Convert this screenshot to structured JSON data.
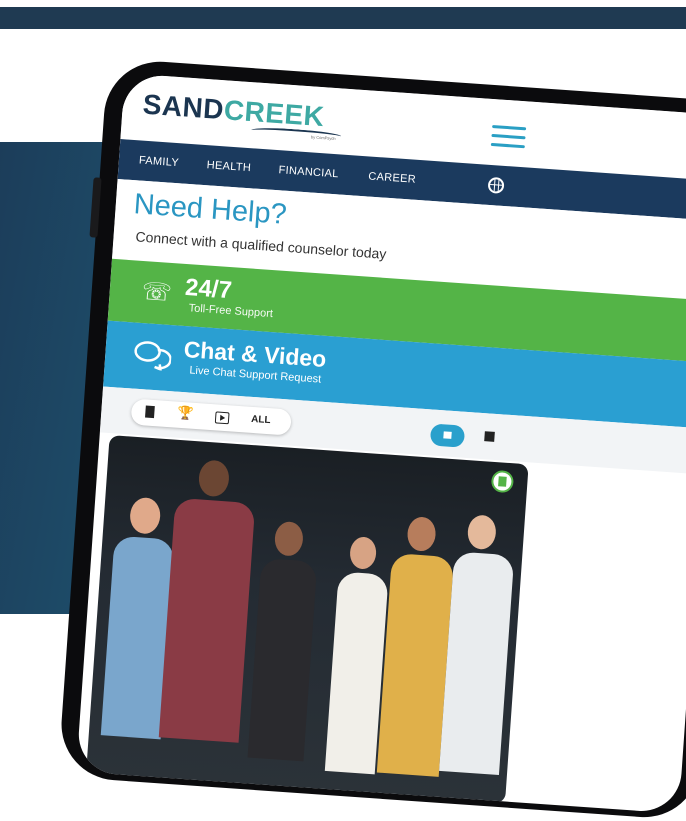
{
  "brand": {
    "name_part1": "SAND",
    "name_part2": "CREEK",
    "tagline": "by ComPsych"
  },
  "nav": {
    "items": [
      "FAMILY",
      "HEALTH",
      "FINANCIAL",
      "CAREER"
    ]
  },
  "help": {
    "title": "Need Help?",
    "subtitle": "Connect with a qualified counselor today"
  },
  "support": {
    "label": "24/7",
    "sub": "Toll-Free Support"
  },
  "chat": {
    "label": "Chat & Video",
    "sub": "Live Chat Support Request"
  },
  "filters": {
    "all_label": "ALL"
  },
  "colors": {
    "nav": "#1b3a5e",
    "green": "#54b447",
    "blue": "#2a9fd2",
    "accent": "#3ea9a3"
  },
  "icons": [
    "menu-icon",
    "globe-icon",
    "phone-icon",
    "chat-icon",
    "document-icon",
    "trophy-icon",
    "video-icon",
    "grid-view-icon",
    "list-view-icon"
  ]
}
